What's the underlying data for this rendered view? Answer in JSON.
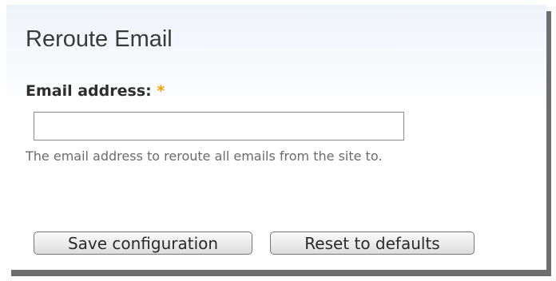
{
  "form": {
    "title": "Reroute Email",
    "email_label": "Email address:",
    "required_marker": "*",
    "email_value": "",
    "email_description": "The email address to reroute all emails from the site to."
  },
  "actions": {
    "save_label": "Save configuration",
    "reset_label": "Reset to defaults"
  },
  "colors": {
    "required_marker": "#f0a000",
    "panel_shadow": "#6e6e6e",
    "panel_gradient_top": "#eef3fa"
  }
}
